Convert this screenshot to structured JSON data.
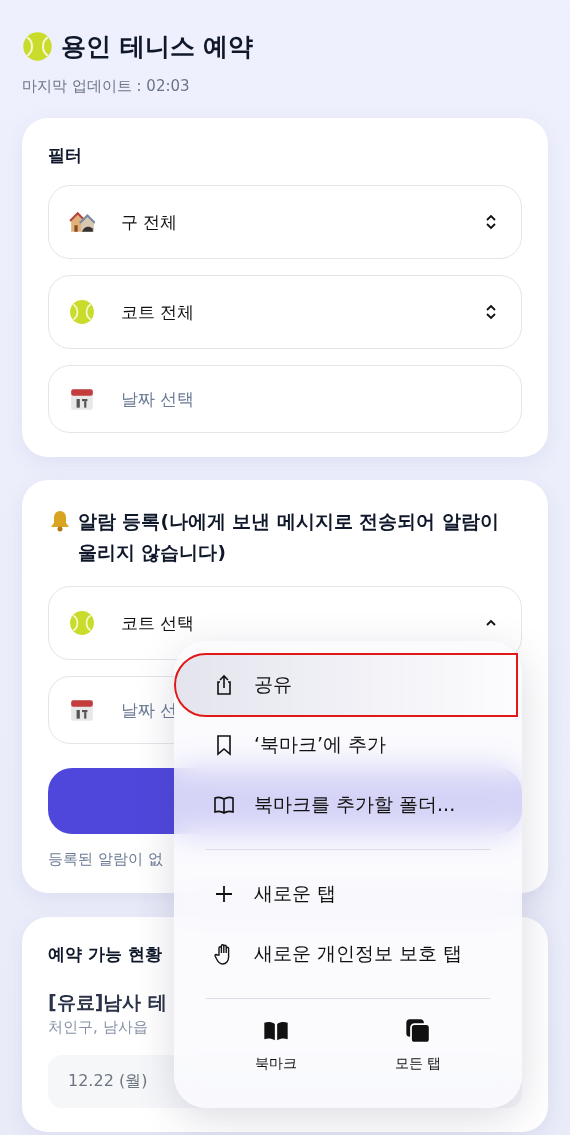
{
  "header": {
    "title": "용인 테니스 예약",
    "updated": "마지막 업데이트 : 02:03"
  },
  "filter_card": {
    "title": "필터",
    "fields": [
      {
        "kind": "district",
        "value": "구 전체",
        "expanded": false
      },
      {
        "kind": "court",
        "value": "코트 전체",
        "expanded": false
      },
      {
        "kind": "date",
        "placeholder": "날짜 선택"
      }
    ]
  },
  "alarm_card": {
    "title": "알람 등록(나에게 보낸 메시지로 전송되어 알람이 울리지 않습니다)",
    "fields": [
      {
        "kind": "court",
        "value": "코트 선택",
        "expanded": true
      },
      {
        "kind": "date",
        "placeholder": "날짜 선"
      }
    ],
    "empty_note": "등록된 알람이 없"
  },
  "availability_card": {
    "title": "예약 가능 현황",
    "court": "[유료]남사 테",
    "location": "처인구, 남사읍",
    "date": "12.22 (월)"
  },
  "context_menu": {
    "sections": [
      [
        {
          "kind": "share",
          "label": "공유",
          "selected": true
        },
        {
          "kind": "bookmark-add",
          "label": "‘북마크’에 추가",
          "selected": false
        },
        {
          "kind": "folder",
          "label": "북마크를 추가할 폴더...",
          "selected": false
        }
      ],
      [
        {
          "kind": "new-tab",
          "label": "새로운 탭",
          "selected": false
        },
        {
          "kind": "private-tab",
          "label": "새로운 개인정보 보호 탭",
          "selected": false
        }
      ]
    ],
    "bottom": [
      {
        "kind": "bookmarks",
        "label": "북마크"
      },
      {
        "kind": "all-tabs",
        "label": "모든 탭"
      }
    ]
  }
}
